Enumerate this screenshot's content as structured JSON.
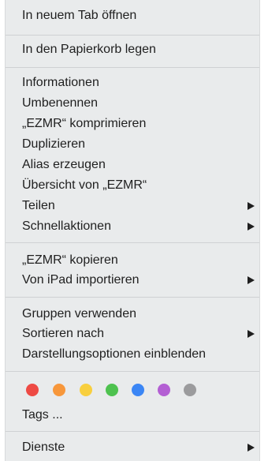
{
  "menu": {
    "open_new_tab": "In neuem Tab öffnen",
    "move_to_trash": "In den Papierkorb legen",
    "get_info": "Informationen",
    "rename": "Umbenennen",
    "compress": "„EZMR“ komprimieren",
    "duplicate": "Duplizieren",
    "make_alias": "Alias erzeugen",
    "quick_look": "Übersicht von „EZMR“",
    "share": "Teilen",
    "quick_actions": "Schnellaktionen",
    "copy": "„EZMR“ kopieren",
    "import_from_ipad": "Von iPad importieren",
    "use_groups": "Gruppen verwenden",
    "sort_by": "Sortieren nach",
    "show_view_options": "Darstellungsoptionen einblenden",
    "tags": "Tags ...",
    "services": "Dienste"
  },
  "tag_colors": [
    {
      "name": "red",
      "color": "#ee4a44"
    },
    {
      "name": "orange",
      "color": "#f7973b"
    },
    {
      "name": "yellow",
      "color": "#f8cf3e"
    },
    {
      "name": "green",
      "color": "#4ec24f"
    },
    {
      "name": "blue",
      "color": "#3b86f5"
    },
    {
      "name": "purple",
      "color": "#b35fd3"
    },
    {
      "name": "gray",
      "color": "#9b9b9d"
    }
  ]
}
